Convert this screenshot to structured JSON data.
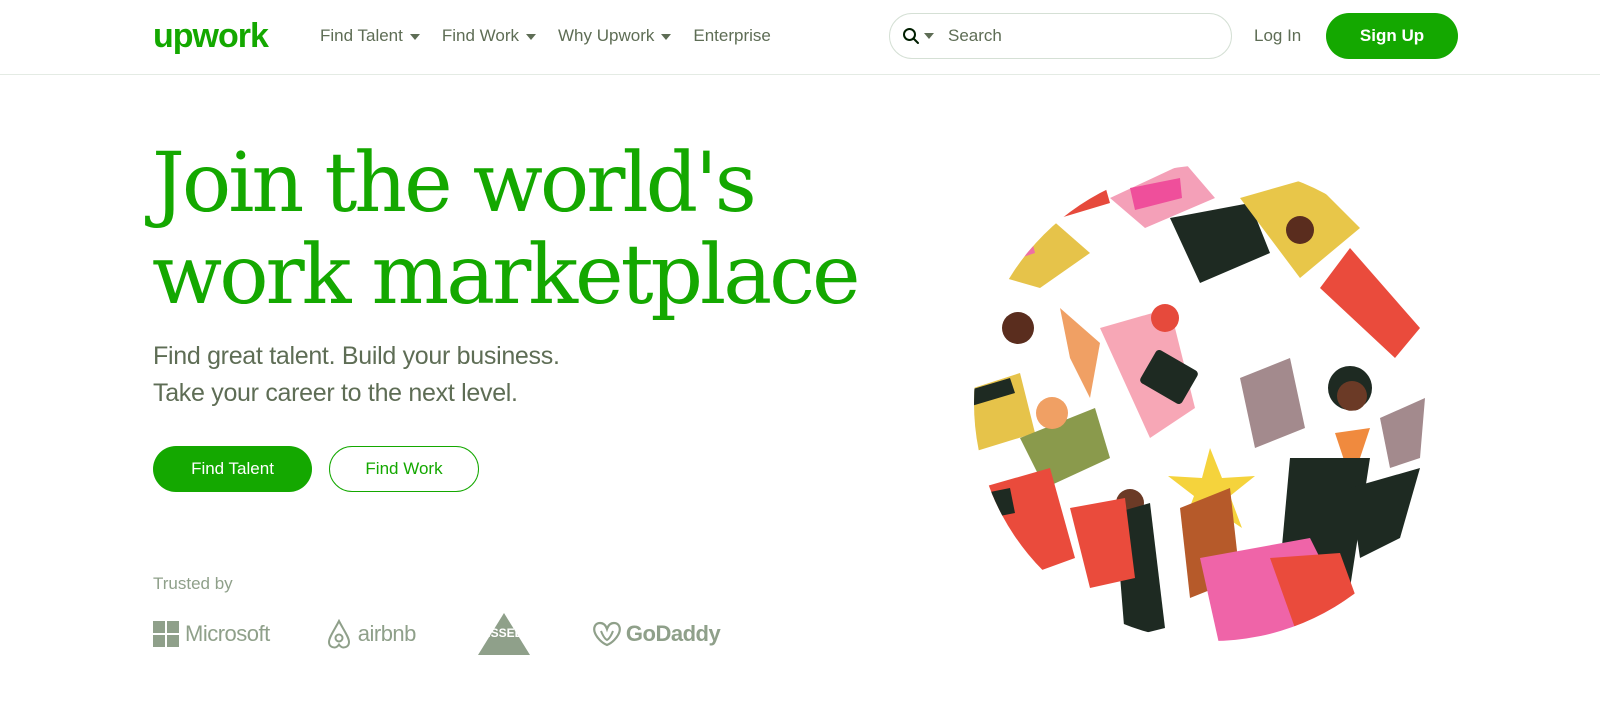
{
  "header": {
    "logo_text": "upwork",
    "nav": [
      {
        "label": "Find Talent",
        "has_dropdown": true
      },
      {
        "label": "Find Work",
        "has_dropdown": true
      },
      {
        "label": "Why Upwork",
        "has_dropdown": true
      },
      {
        "label": "Enterprise",
        "has_dropdown": false
      }
    ],
    "search": {
      "placeholder": "Search",
      "icon": "search-icon"
    },
    "login_label": "Log In",
    "signup_label": "Sign Up"
  },
  "hero": {
    "title_lines": [
      "Join the world's",
      "work marketplace"
    ],
    "subtitle_lines": [
      "Find great talent. Build your business.",
      "Take your career to the next level."
    ],
    "primary_cta": "Find Talent",
    "secondary_cta": "Find Work"
  },
  "trusted": {
    "label": "Trusted by",
    "brands": [
      "Microsoft",
      "airbnb",
      "BISSELL",
      "GoDaddy"
    ]
  },
  "colors": {
    "brand_green": "#14a800",
    "text_muted": "#5e6d55",
    "logo_gray": "#8fa08a"
  }
}
